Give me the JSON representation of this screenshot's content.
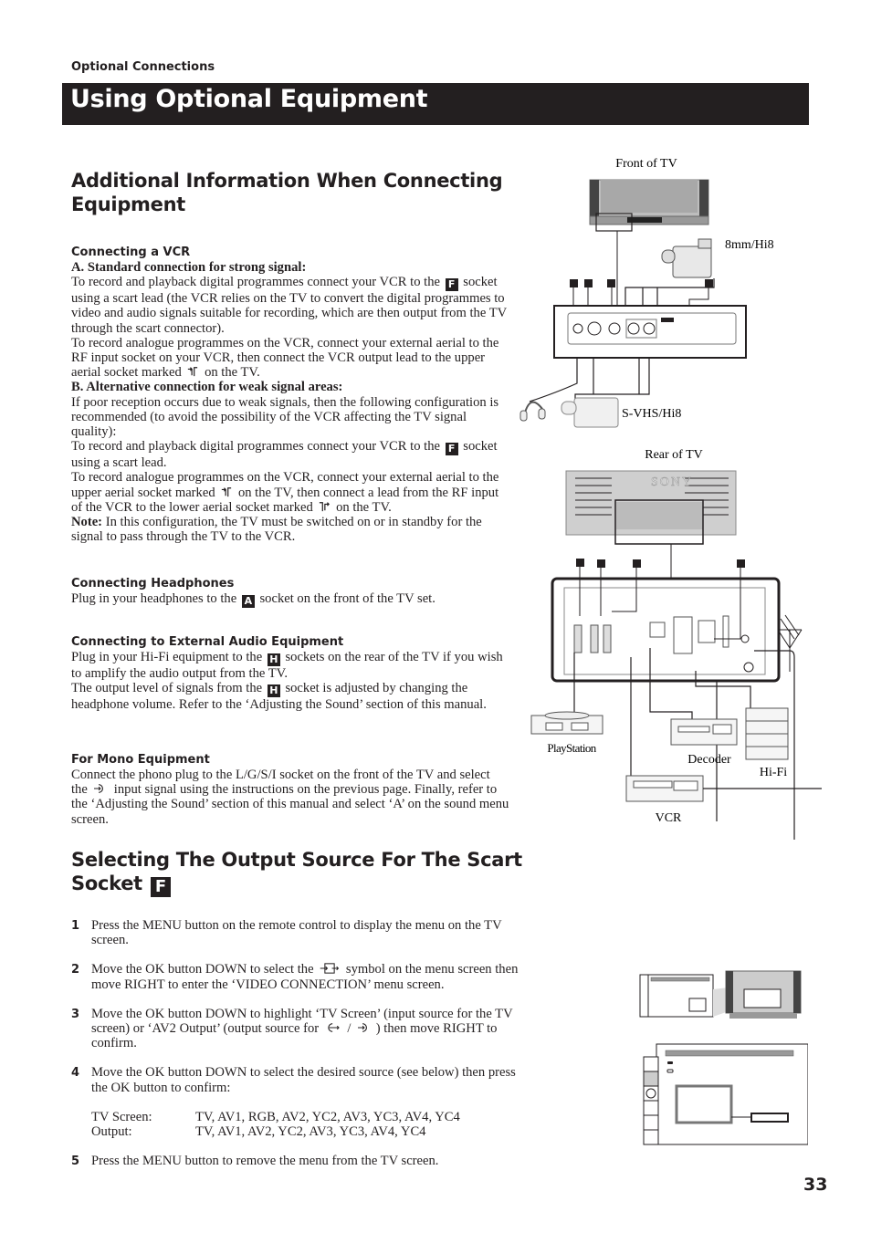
{
  "header": {
    "section_label": "Optional Connections",
    "title": "Using Optional Equipment",
    "title_bar_color": "#231f20"
  },
  "additional": {
    "heading": "Additional Information When Connecting Equipment",
    "vcr": {
      "heading": "Connecting a VCR",
      "a_heading": "A. Standard connection for strong signal:",
      "a_p1_before": "To record and playback digital programmes connect your VCR to the",
      "a_p1_badge": "F",
      "a_p1_after": "socket using a scart lead (the VCR relies on the TV to convert the digital programmes to video and audio signals suitable for recording, which are then output from the TV through the scart connector).",
      "a_p2_before": "To record analogue programmes on the VCR, connect your external aerial to the RF input socket on your VCR, then connect the VCR output lead to the upper aerial socket marked",
      "a_p2_after": "on the TV.",
      "b_heading": "B. Alternative connection for  weak signal areas:",
      "b_p1": "If poor reception occurs due to weak signals, then the following configuration is recommended (to avoid the possibility of the VCR affecting the TV signal quality):",
      "b_p2_before": "To record and playback digital programmes connect your VCR to the",
      "b_p2_badge": "F",
      "b_p2_after": "socket using a scart lead.",
      "b_p3_before": "To record analogue programmes on the VCR, connect your external aerial to the upper aerial socket marked",
      "b_p3_mid": "on the TV, then connect a lead from the RF input of the VCR to the lower aerial socket marked",
      "b_p3_after": "on the TV.",
      "note_label": "Note:",
      "note_text": "In this configuration, the TV must be switched on or in standby for the signal to pass through the TV to the VCR."
    },
    "headphones": {
      "heading": "Connecting Headphones",
      "before": "Plug in your headphones to the",
      "badge": "A",
      "after": "socket on the front of the TV set."
    },
    "audio": {
      "heading": "Connecting to External Audio Equipment",
      "p1_before": "Plug in your Hi-Fi equipment to the",
      "p1_badge": "H",
      "p1_after": "sockets on the rear of the TV if you wish to amplify the audio output from the TV.",
      "p2_before": "The output level of signals from the",
      "p2_badge": "H",
      "p2_after": "socket is adjusted by changing the headphone volume. Refer to the ‘Adjusting the Sound’ section of this manual."
    },
    "mono": {
      "heading": "For Mono Equipment",
      "p1_before": "Connect the phono plug to the L/G/S/I socket on the front of the TV and select the",
      "p1_after": "input signal using the instructions on the previous page. Finally, refer to the ‘Adjusting the Sound’ section of this manual and select ‘A’ on the sound menu screen."
    }
  },
  "selecting": {
    "heading": "Selecting The Output Source For The Scart Socket",
    "heading_badge": "F",
    "steps": [
      {
        "num": "1",
        "text": "Press the MENU button on the remote control to display the menu on the TV screen."
      },
      {
        "num": "2",
        "before": "Move the OK button DOWN to select the",
        "after": "symbol on the menu screen then move RIGHT to enter the ‘VIDEO CONNECTION’ menu screen."
      },
      {
        "num": "3",
        "before": "Move the OK button DOWN to highlight ‘TV Screen’ (input source for the TV screen) or ‘AV2 Output’ (output source for",
        "sep": "/",
        "after": ") then move RIGHT to confirm."
      },
      {
        "num": "4",
        "text": "Move the OK button DOWN to select the desired source (see below) then press the OK button to confirm:"
      },
      {
        "num": "5",
        "text": "Press the MENU button to remove the menu from the TV screen."
      }
    ],
    "sources": [
      {
        "label": "TV Screen:",
        "value": "TV, AV1, RGB, AV2, YC2, AV3, YC3, AV4, YC4"
      },
      {
        "label": "Output:",
        "value": "TV, AV1, AV2, YC2, AV3, YC3, AV4, YC4"
      }
    ]
  },
  "diagram": {
    "front_caption": "Front of TV",
    "cam_8mm": "8mm/Hi8",
    "cam_svhs": "S-VHS/Hi8",
    "rear_caption": "Rear of TV",
    "brand": "SONY",
    "playstation": "PlayStation",
    "decoder": "Decoder",
    "hifi": "Hi-Fi",
    "vcr": "VCR"
  },
  "page": {
    "number": "33"
  }
}
